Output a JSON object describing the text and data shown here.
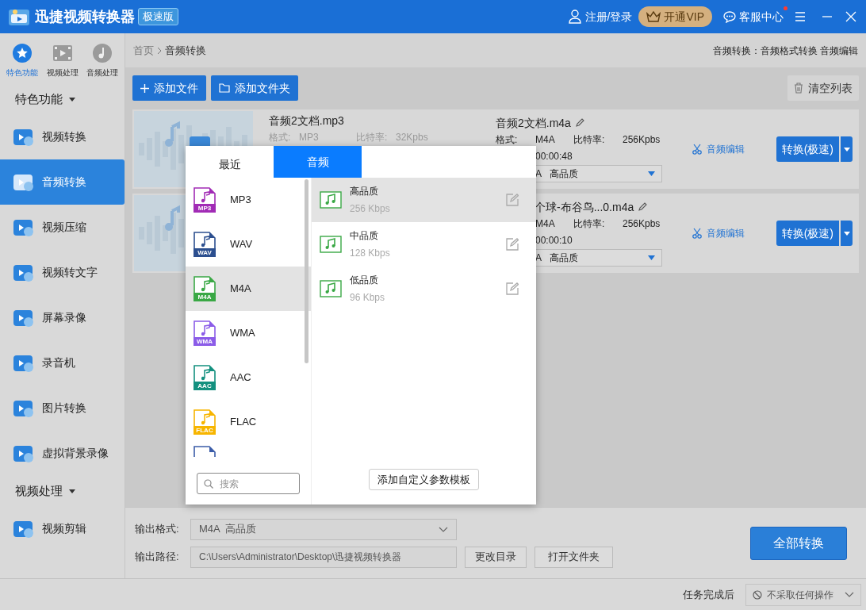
{
  "title_bar": {
    "app_name": "迅捷视频转换器",
    "edition": "极速版",
    "login": "注册/登录",
    "vip": "开通VIP",
    "support": "客服中心",
    "support_unread": true
  },
  "sidebar": {
    "modes": [
      {
        "label": "特色功能",
        "selected": true
      },
      {
        "label": "视频处理",
        "selected": false
      },
      {
        "label": "音频处理",
        "selected": false
      }
    ],
    "sections": [
      {
        "title": "特色功能",
        "items": [
          {
            "label": "视频转换",
            "selected": false
          },
          {
            "label": "音频转换",
            "selected": true
          },
          {
            "label": "视频压缩",
            "selected": false
          },
          {
            "label": "视频转文字",
            "selected": false
          },
          {
            "label": "屏幕录像",
            "selected": false
          },
          {
            "label": "录音机",
            "selected": false
          },
          {
            "label": "图片转换",
            "selected": false
          },
          {
            "label": "虚拟背景录像",
            "selected": false
          }
        ]
      },
      {
        "title": "视频处理",
        "items": [
          {
            "label": "视频剪辑",
            "selected": false
          }
        ]
      }
    ]
  },
  "breadcrumb": [
    "首页",
    "音频转换"
  ],
  "breadcrumb_right": "音频转换：音频格式转换 音频编辑",
  "toolbar": {
    "add_file": "添加文件",
    "add_folder": "添加文件夹",
    "clear": "清空列表"
  },
  "files": [
    {
      "source": {
        "name": "音频2文档.mp3",
        "format_label": "格式:",
        "format": "MP3",
        "bitrate_label": "比特率:",
        "bitrate": "32Kpbs"
      },
      "output": {
        "name": "音频2文档.m4a",
        "format_label": "格式:",
        "format": "M4A",
        "bitrate_label": "比特率:",
        "bitrate": "256Kpbs",
        "duration": "00:00:48",
        "preset_format": "A",
        "preset_quality": "高品质"
      },
      "edit": "音频编辑",
      "convert": "转换(极速)"
    },
    {
      "output": {
        "name": "个球-布谷鸟...0.m4a",
        "format": "M4A",
        "bitrate_label": "比特率:",
        "bitrate": "256Kpbs",
        "duration": "00:00:10",
        "preset_format": "A",
        "preset_quality": "高品质"
      },
      "edit": "音频编辑",
      "convert": "转换(极速)"
    }
  ],
  "format_popup": {
    "tabs": [
      {
        "label": "最近",
        "selected": false
      },
      {
        "label": "音频",
        "selected": true
      }
    ],
    "formats": [
      {
        "name": "MP3",
        "badge": "MP3",
        "color": "#a12bb5",
        "selected": false
      },
      {
        "name": "WAV",
        "badge": "WAV",
        "color": "#2c4f8f",
        "selected": false
      },
      {
        "name": "M4A",
        "badge": "M4A",
        "color": "#3aa845",
        "selected": true
      },
      {
        "name": "WMA",
        "badge": "WMA",
        "color": "#8b5ce8",
        "selected": false
      },
      {
        "name": "AAC",
        "badge": "AAC",
        "color": "#13907f",
        "selected": false
      },
      {
        "name": "FLAC",
        "badge": "FLAC",
        "color": "#f7b500",
        "selected": false
      }
    ],
    "presets": [
      {
        "name": "高品质",
        "bitrate": "256 Kbps",
        "selected": true
      },
      {
        "name": "中品质",
        "bitrate": "128 Kbps",
        "selected": false
      },
      {
        "name": "低品质",
        "bitrate": "96 Kbps",
        "selected": false
      }
    ],
    "search_placeholder": "搜索",
    "add_template": "添加自定义参数模板"
  },
  "output": {
    "format_label": "输出格式:",
    "format_value": "M4A  高品质",
    "path_label": "输出路径:",
    "path": "C:\\Users\\Administrator\\Desktop\\迅捷视频转换器",
    "change_dir": "更改目录",
    "open_folder": "打开文件夹",
    "convert_all": "全部转换"
  },
  "status_bar": {
    "after_label": "任务完成后",
    "after_value": "不采取任何操作"
  }
}
